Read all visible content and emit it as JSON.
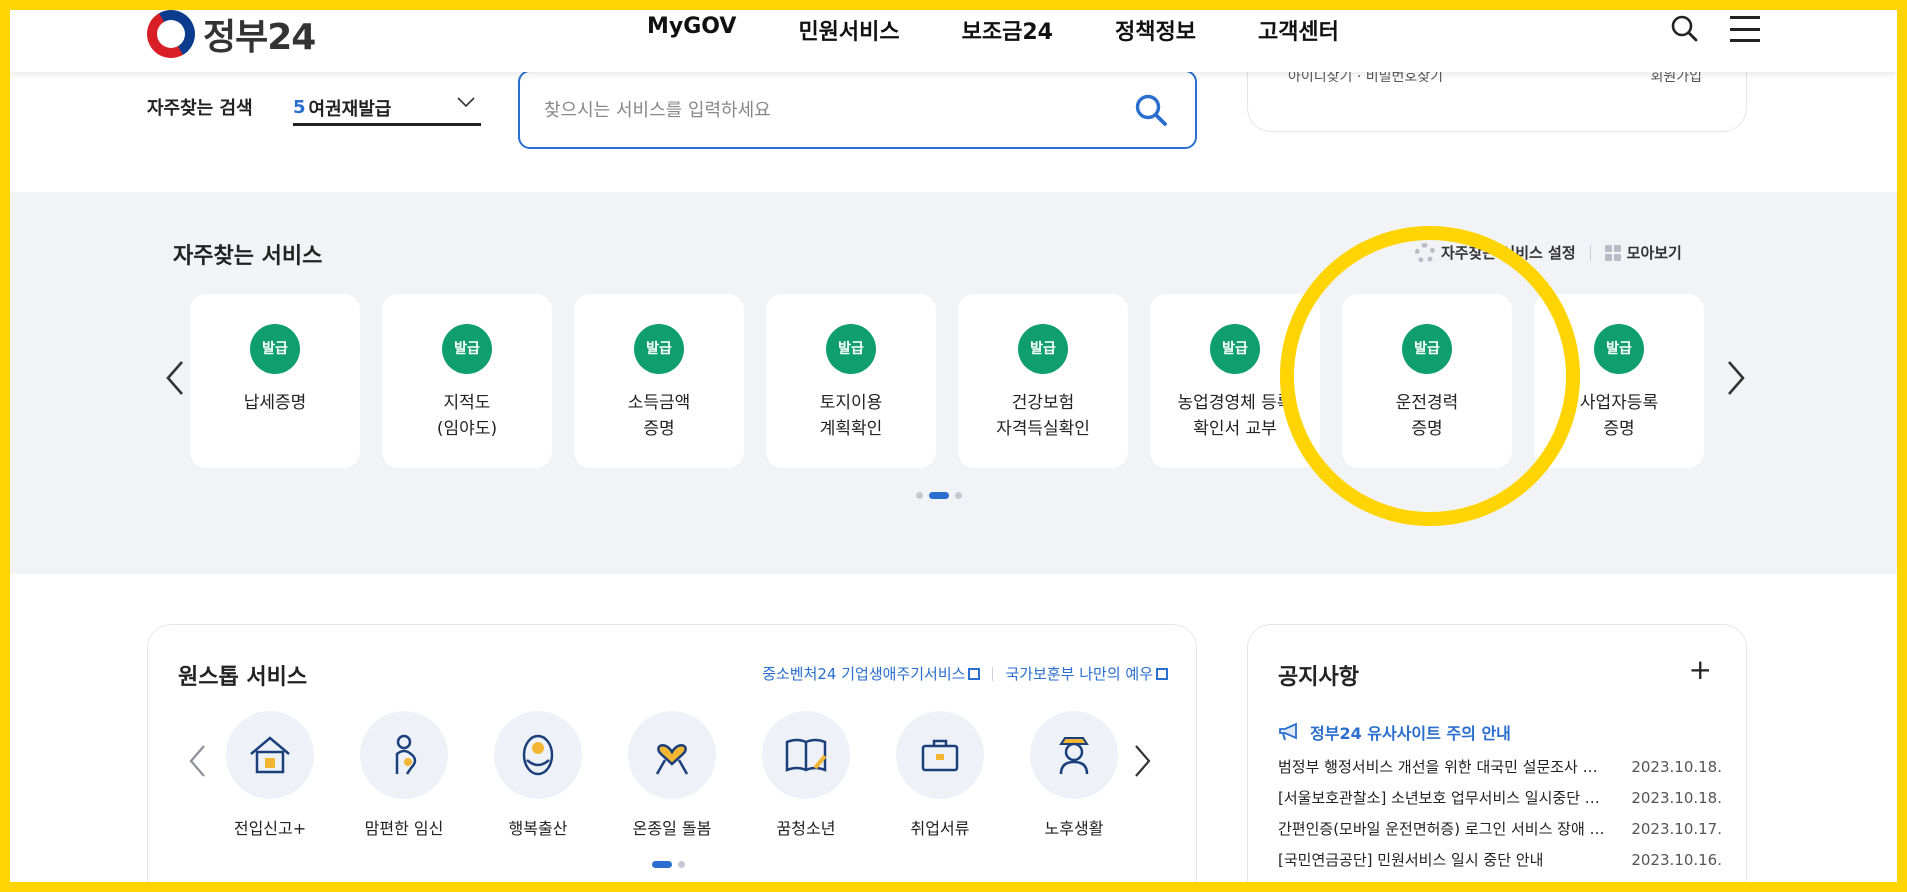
{
  "header": {
    "logo_text": "정부24",
    "nav": [
      "MyGOV",
      "민원서비스",
      "보조금24",
      "정책정보",
      "고객센터"
    ],
    "search_icon": "search-icon",
    "menu_icon": "hamburger-menu-icon"
  },
  "search": {
    "frequent_label": "자주찾는 검색",
    "frequent_num": "5",
    "frequent_value": "여권재발급",
    "placeholder": "찾으시는 서비스를 입력하세요"
  },
  "login_card": {
    "left_text": "아이디찾기 · 비밀번호찾기",
    "right_text": "회원가입"
  },
  "frequent_services": {
    "title": "자주찾는 서비스",
    "settings_label": "자주찾는 서비스 설정",
    "view_all_label": "모아보기",
    "cards": [
      {
        "badge": "발급",
        "label": "납세증명"
      },
      {
        "badge": "발급",
        "label": "지적도\n(임야도)"
      },
      {
        "badge": "발급",
        "label": "소득금액\n증명"
      },
      {
        "badge": "발급",
        "label": "토지이용\n계획확인"
      },
      {
        "badge": "발급",
        "label": "건강보험\n자격득실확인"
      },
      {
        "badge": "발급",
        "label": "농업경영체 등록\n확인서 교부"
      },
      {
        "badge": "발급",
        "label": "운전경력\n증명"
      },
      {
        "badge": "발급",
        "label": "사업자등록\n증명"
      }
    ],
    "page_dots": 3,
    "active_dot": 2
  },
  "one_stop": {
    "title": "원스톱 서비스",
    "links": [
      "중소벤처24 기업생애주기서비스",
      "국가보훈부 나만의 예우"
    ],
    "items": [
      {
        "icon": "house-icon",
        "label": "전입신고+"
      },
      {
        "icon": "pregnant-person-icon",
        "label": "맘편한 임신"
      },
      {
        "icon": "baby-icon",
        "label": "행복출산"
      },
      {
        "icon": "ribbon-heart-icon",
        "label": "온종일 돌봄"
      },
      {
        "icon": "open-book-icon",
        "label": "꿈청소년"
      },
      {
        "icon": "briefcase-icon",
        "label": "취업서류"
      },
      {
        "icon": "elderly-person-icon",
        "label": "노후생활"
      }
    ],
    "page_dots": 2,
    "active_dot": 1
  },
  "notice": {
    "title": "공지사항",
    "more": "+",
    "warning": "정부24 유사사이트 주의 안내",
    "items": [
      {
        "title": "범정부 행정서비스 개선을 위한 대국민 설문조사 …",
        "date": "2023.10.18."
      },
      {
        "title": "[서울보호관찰소] 소년보호 업무서비스 일시중단 …",
        "date": "2023.10.18."
      },
      {
        "title": "간편인증(모바일 운전면허증) 로그인 서비스 장애 …",
        "date": "2023.10.17."
      },
      {
        "title": "[국민연금공단] 민원서비스 일시 중단 안내",
        "date": "2023.10.16."
      }
    ]
  },
  "colors": {
    "accent": "#2a6ecf",
    "badge": "#0f9e6e",
    "highlight": "#ffd400",
    "section_bg": "#f1f3f7"
  }
}
